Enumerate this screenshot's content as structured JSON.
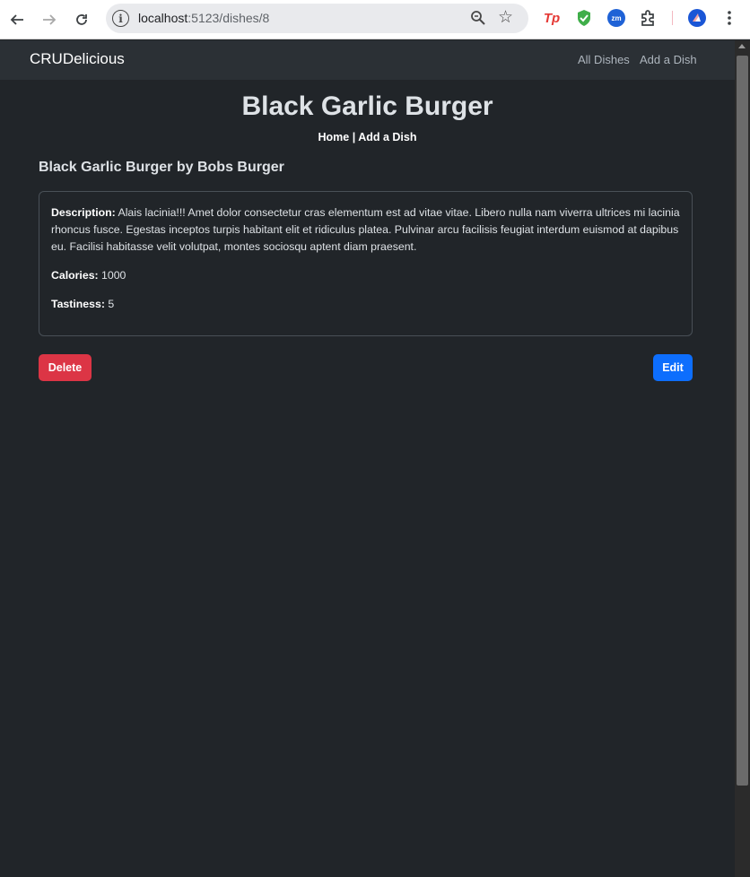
{
  "browser": {
    "url_host": "localhost",
    "url_path": ":5123/dishes/8"
  },
  "navbar": {
    "brand": "CRUDelicious",
    "links": [
      "All Dishes",
      "Add a Dish"
    ]
  },
  "page": {
    "title": "Black Garlic Burger",
    "breadcrumb": {
      "home": "Home",
      "separator": " | ",
      "add": "Add a Dish"
    },
    "subheading": "Black Garlic Burger by Bobs Burger"
  },
  "details": {
    "description_label": "Description:",
    "description": " Alais lacinia!!! Amet dolor consectetur cras elementum est ad vitae vitae. Libero nulla nam viverra ultrices mi lacinia rhoncus fusce. Egestas inceptos turpis habitant elit et ridiculus platea. Pulvinar arcu facilisis feugiat interdum euismod at dapibus eu. Facilisi habitasse velit volutpat, montes sociosqu aptent diam praesent.",
    "calories_label": "Calories:",
    "calories": " 1000",
    "tastiness_label": "Tastiness:",
    "tastiness": " 5"
  },
  "actions": {
    "delete": "Delete",
    "edit": "Edit"
  },
  "colors": {
    "background": "#212529",
    "navbar": "#2b3035",
    "danger": "#dc3545",
    "primary": "#0d6efd"
  },
  "icons": {
    "back": "arrow-left-icon",
    "forward": "arrow-right-icon",
    "reload": "reload-icon",
    "site_info": "info-icon",
    "zoom": "zoom-icon",
    "bookmark": "star-icon",
    "menu": "kebab-menu-icon"
  }
}
